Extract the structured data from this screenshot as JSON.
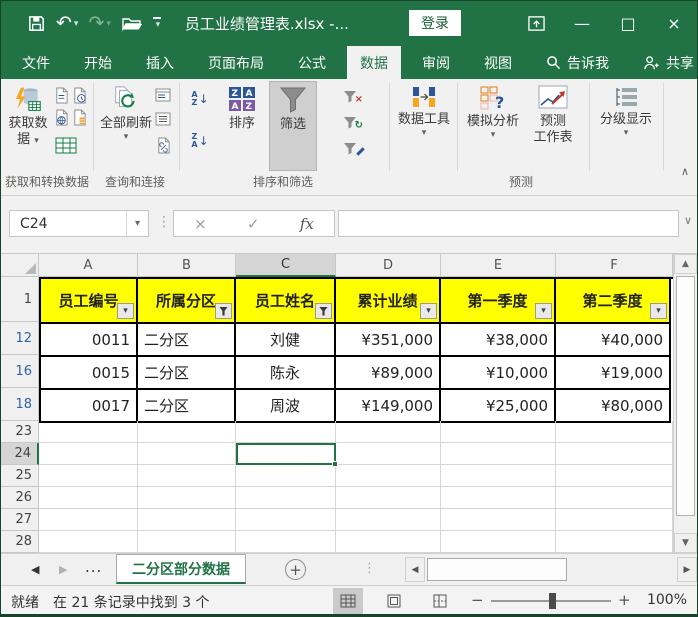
{
  "colors": {
    "accent_green": "#217346",
    "header_fill_yellow": "#ffff00",
    "filtered_row_number_blue": "#2e63a5",
    "selection_border_green": "#217346"
  },
  "icons": {
    "caret_down": "▾",
    "undo": "↶",
    "redo": "↷",
    "close": "×",
    "minimize": "—",
    "maximize": "□",
    "check": "✓",
    "cancel_x": "×",
    "splitter_dots": "⋮",
    "collapse_chevron": "∧",
    "expand_chevron": "∨",
    "scroll_up": "▲",
    "scroll_down": "▼",
    "scroll_left": "◀",
    "scroll_right": "▶",
    "plus": "+",
    "minus": "−",
    "ellipsis": "...",
    "sort_a": "A",
    "sort_z": "Z",
    "sort_arrow": "↓",
    "clear_x": "×",
    "reapply": "↻"
  },
  "titlebar": {
    "title": "员工业绩管理表.xlsx -...",
    "sign_in_label": "登录"
  },
  "menubar": {
    "tabs": [
      {
        "label": "文件"
      },
      {
        "label": "开始"
      },
      {
        "label": "插入"
      },
      {
        "label": "页面布局"
      },
      {
        "label": "公式"
      },
      {
        "label": "数据"
      },
      {
        "label": "审阅"
      },
      {
        "label": "视图"
      },
      {
        "label": "告诉我"
      },
      {
        "label": "共享"
      }
    ],
    "active_tab": "数据"
  },
  "ribbon": {
    "get_data_line1": "获取数",
    "get_data_line2": "据",
    "refresh_all_label": "全部刷新",
    "sort_label": "排序",
    "filter_label": "筛选",
    "data_tools_label": "数据工具",
    "what_if_label": "模拟分析",
    "forecast_line1": "预测",
    "forecast_line2": "工作表",
    "outline_label": "分级显示",
    "group_labels": {
      "get_transform": "获取和转换数据",
      "queries_connections": "查询和连接",
      "sort_filter": "排序和筛选",
      "forecast": "预测"
    }
  },
  "formula_bar": {
    "name_box": "C24",
    "fx_label": "fx",
    "formula_value": ""
  },
  "grid": {
    "column_letters": [
      "A",
      "B",
      "C",
      "D",
      "E",
      "F"
    ],
    "selected_column": "C",
    "selected_cell": "C24",
    "header_row_number": "1",
    "header_cells": [
      {
        "label": "员工编号",
        "filtered": false
      },
      {
        "label": "所属分区",
        "filtered": true
      },
      {
        "label": "员工姓名",
        "filtered": true
      },
      {
        "label": "累计业绩",
        "filtered": false
      },
      {
        "label": "第一季度",
        "filtered": false
      },
      {
        "label": "第二季度",
        "filtered": false
      }
    ],
    "rows": [
      {
        "num": "12",
        "cells": [
          "0011",
          "二分区",
          "刘健",
          "¥351,000",
          "¥38,000",
          "¥40,000"
        ]
      },
      {
        "num": "16",
        "cells": [
          "0015",
          "二分区",
          "陈永",
          "¥89,000",
          "¥10,000",
          "¥19,000"
        ]
      },
      {
        "num": "18",
        "cells": [
          "0017",
          "二分区",
          "周波",
          "¥149,000",
          "¥25,000",
          "¥80,000"
        ]
      }
    ],
    "empty_row_numbers": [
      "23",
      "24",
      "25",
      "26",
      "27",
      "28"
    ]
  },
  "sheet_bar": {
    "tab_name": "二分区部分数据"
  },
  "status_bar": {
    "ready": "就绪",
    "filter_status": "在 21 条记录中找到 3 个",
    "zoom_level": "100%"
  }
}
